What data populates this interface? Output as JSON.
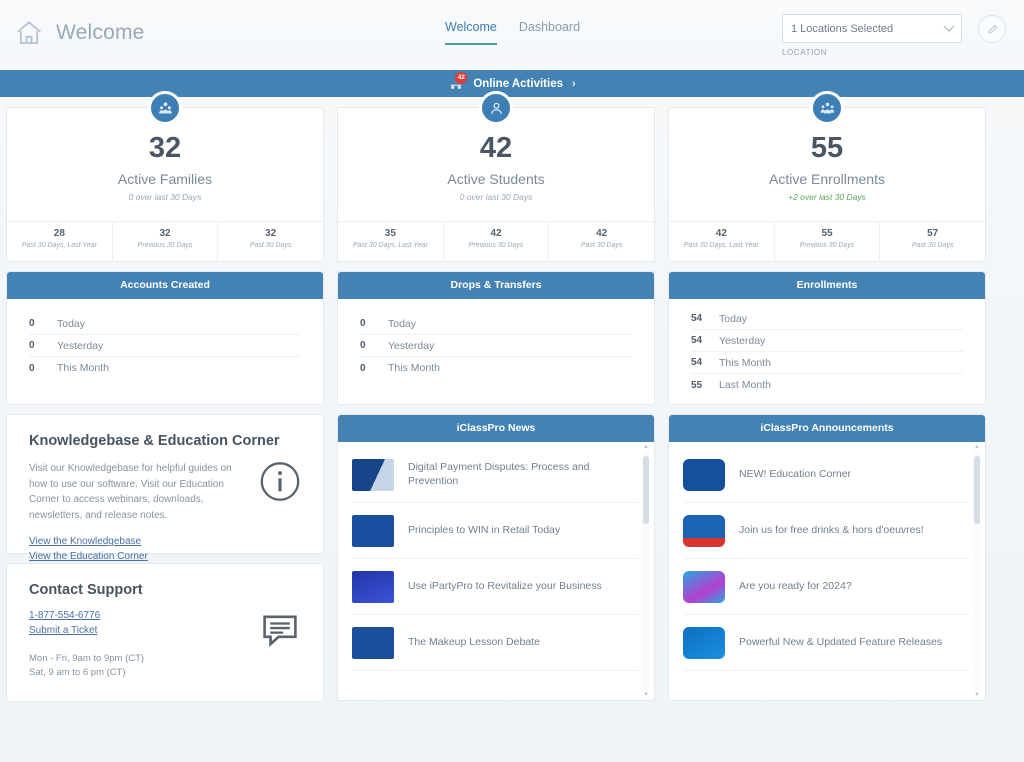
{
  "header": {
    "home_icon": "home-icon",
    "title": "Welcome",
    "tabs": [
      {
        "label": "Welcome",
        "active": true
      },
      {
        "label": "Dashboard",
        "active": false
      }
    ],
    "location": {
      "value": "1 Locations Selected",
      "caption": "LOCATION",
      "chevron_icon": "chevron-down-icon"
    },
    "edit_icon": "pencil-icon"
  },
  "activities_bar": {
    "label": "Online Activities",
    "badge": "42",
    "arrow": "›",
    "icon": "activities-icon",
    "background": "#4582b4"
  },
  "stats": [
    {
      "icon": "families-icon",
      "value": "32",
      "label": "Active Families",
      "delta": "0 over last 30 Days",
      "delta_positive": false,
      "footer": [
        {
          "value": "28",
          "label": "Past 30 Days, Last Year"
        },
        {
          "value": "32",
          "label": "Previous 30 Days"
        },
        {
          "value": "32",
          "label": "Past 30 Days"
        }
      ]
    },
    {
      "icon": "student-icon",
      "value": "42",
      "label": "Active Students",
      "delta": "0 over last 30 Days",
      "delta_positive": false,
      "footer": [
        {
          "value": "35",
          "label": "Past 30 Days, Last Year"
        },
        {
          "value": "42",
          "label": "Previous 30 Days"
        },
        {
          "value": "42",
          "label": "Past 30 Days"
        }
      ]
    },
    {
      "icon": "enrollments-icon",
      "value": "55",
      "label": "Active Enrollments",
      "delta": "+2 over last 30 Days",
      "delta_positive": true,
      "footer": [
        {
          "value": "42",
          "label": "Past 30 Days, Last Year"
        },
        {
          "value": "55",
          "label": "Previous 30 Days"
        },
        {
          "value": "57",
          "label": "Past 30 Days"
        }
      ]
    }
  ],
  "panels": [
    {
      "title": "Accounts Created",
      "rows": [
        {
          "value": "0",
          "label": "Today"
        },
        {
          "value": "0",
          "label": "Yesterday"
        },
        {
          "value": "0",
          "label": "This Month"
        }
      ]
    },
    {
      "title": "Drops & Transfers",
      "rows": [
        {
          "value": "0",
          "label": "Today"
        },
        {
          "value": "0",
          "label": "Yesterday"
        },
        {
          "value": "0",
          "label": "This Month"
        }
      ]
    },
    {
      "title": "Enrollments",
      "rows": [
        {
          "value": "54",
          "label": "Today"
        },
        {
          "value": "54",
          "label": "Yesterday"
        },
        {
          "value": "54",
          "label": "This Month"
        },
        {
          "value": "55",
          "label": "Last Month"
        }
      ]
    }
  ],
  "knowledgebase": {
    "title": "Knowledgebase & Education Corner",
    "body": "Visit our Knowledgebase for helpful guides on how to use our software. Visit our Education Corner to access webinars, downloads, newsletters, and release notes.",
    "link_1": "View the Knowledgebase",
    "link_2": "View the Education Corner",
    "icon": "info-circle-icon"
  },
  "contact_support": {
    "title": "Contact Support",
    "phone": "1-877-554-6776",
    "ticket_link": "Submit a Ticket",
    "hours_1": "Mon - Fri, 9am to 9pm (CT)",
    "hours_2": "Sat, 9 am to 6 pm (CT)",
    "icon": "chat-bubble-icon"
  },
  "news": {
    "title": "iClassPro News",
    "items": [
      {
        "title": "Digital Payment Disputes: Process and Prevention",
        "thumb": "payment-disputes-thumb",
        "color": "#1d4f91"
      },
      {
        "title": "Principles to WIN in Retail Today",
        "thumb": "retail-principles-thumb",
        "color": "#1a4fa0"
      },
      {
        "title": "Use iPartyPro to Revitalize your Business",
        "thumb": "ipartypro-thumb",
        "color": "#2b3da8"
      },
      {
        "title": "The Makeup Lesson Debate",
        "thumb": "makeup-lesson-thumb",
        "color": "#1b4f9c"
      }
    ]
  },
  "announcements": {
    "title": "iClassPro Announcements",
    "items": [
      {
        "title": "NEW! Education Corner",
        "thumb": "education-corner-thumb",
        "color": "#14509b"
      },
      {
        "title": "Join us for free drinks & hors d'oeuvres!",
        "thumb": "free-drinks-thumb",
        "color": "#1b63b5"
      },
      {
        "title": "Are you ready for 2024?",
        "thumb": "ready-2024-thumb",
        "color": "#2aa6e0"
      },
      {
        "title": "Powerful New & Updated Feature Releases",
        "thumb": "feature-releases-thumb",
        "color": "#0d6fc0"
      }
    ]
  },
  "colors": {
    "accent_blue": "#4582b4",
    "panel_header": "#4582b4",
    "positive_green": "#5ba55b",
    "badge_red": "#e03b36",
    "page_bg": "#f4f7fa"
  }
}
